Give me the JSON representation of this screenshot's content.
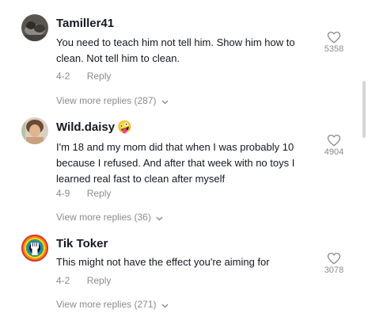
{
  "comments": [
    {
      "username": "Tamiller41",
      "text": "You need to teach him not tell him. Show him how to clean. Not tell him to clean.",
      "date": "4-2",
      "reply_label": "Reply",
      "likes": "5358",
      "view_more": "View more replies (287)",
      "avatar_icon": "profile-photo"
    },
    {
      "username": "Wild.daisy",
      "username_emoji": "🤪",
      "text": "I'm 18 and my mom did that when I was probably 10 because I refused. And after that week with no toys I learned real fast to clean after myself",
      "date": "4-9",
      "reply_label": "Reply",
      "likes": "4904",
      "view_more": "View more replies (36)",
      "avatar_icon": "profile-photo"
    },
    {
      "username": "Tik Toker",
      "text": "This might not have the effect you're aiming for",
      "date": "4-2",
      "reply_label": "Reply",
      "likes": "3078",
      "view_more": "View more replies (271)",
      "avatar_icon": "raised-fist-rainbow"
    }
  ],
  "colors": {
    "text_primary": "#161823",
    "text_secondary": "#8a8b91",
    "scrollbar": "#d5d6da"
  }
}
